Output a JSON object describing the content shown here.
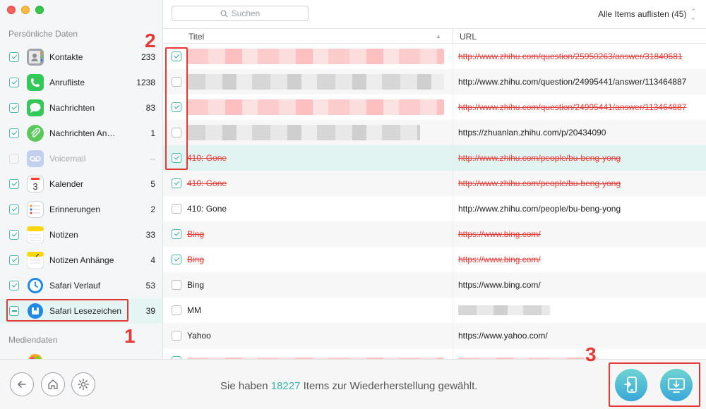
{
  "sidebar": {
    "section_personal": "Persönliche Daten",
    "section_media": "Mediendaten",
    "categories": [
      {
        "name": "Kontakte",
        "count": "233",
        "state": "checked",
        "color": "#8e8e93",
        "icon": "contacts-icon"
      },
      {
        "name": "Anrufliste",
        "count": "1238",
        "state": "checked",
        "color": "#34c759",
        "icon": "phone-icon"
      },
      {
        "name": "Nachrichten",
        "count": "83",
        "state": "checked",
        "color": "#34c759",
        "icon": "messages-icon"
      },
      {
        "name": "Nachrichten An…",
        "count": "1",
        "state": "checked",
        "color": "#5ac85a",
        "icon": "paperclip-icon"
      },
      {
        "name": "Voicemail",
        "count": "--",
        "state": "disabled",
        "color": "#9fb8e6",
        "icon": "voicemail-icon"
      },
      {
        "name": "Kalender",
        "count": "5",
        "state": "checked",
        "color": "#ffffff",
        "icon": "calendar-icon",
        "calendar_day": "3"
      },
      {
        "name": "Erinnerungen",
        "count": "2",
        "state": "checked",
        "color": "#ffffff",
        "icon": "reminders-icon"
      },
      {
        "name": "Notizen",
        "count": "33",
        "state": "checked",
        "color": "#ffd60a",
        "icon": "notes-icon"
      },
      {
        "name": "Notizen Anhänge",
        "count": "4",
        "state": "checked",
        "color": "#ffd60a",
        "icon": "notes-attachment-icon"
      },
      {
        "name": "Safari Verlauf",
        "count": "53",
        "state": "checked",
        "color": "#1e88e5",
        "icon": "safari-history-icon"
      },
      {
        "name": "Safari Lesezeichen",
        "count": "39",
        "state": "partial",
        "color": "#1e88e5",
        "icon": "safari-bookmark-icon",
        "selected": true
      }
    ]
  },
  "toolbar": {
    "search_placeholder": "Suchen",
    "filter_label": "Alle Items auflisten (45)"
  },
  "table": {
    "col_title": "Titel",
    "col_url": "URL",
    "rows": [
      {
        "checked": true,
        "title": "",
        "url": "http://www.zhihu.com/question/25950263/answer/31840681",
        "deleted": true,
        "blur_title": "red"
      },
      {
        "checked": false,
        "title": "",
        "url": "http://www.zhihu.com/question/24995441/answer/113464887",
        "deleted": false,
        "blur_title": "grey"
      },
      {
        "checked": true,
        "title": "",
        "url": "http://www.zhihu.com/question/24995441/answer/113464887",
        "deleted": true,
        "blur_title": "red"
      },
      {
        "checked": false,
        "title": "",
        "url": "https://zhuanlan.zhihu.com/p/20434090",
        "deleted": false,
        "blur_title": "grey"
      },
      {
        "checked": true,
        "title": "410: Gone",
        "url": "http://www.zhihu.com/people/bu-beng-yong",
        "deleted": true,
        "highlight": true
      },
      {
        "checked": true,
        "title": "410: Gone",
        "url": "http://www.zhihu.com/people/bu-beng-yong",
        "deleted": true
      },
      {
        "checked": false,
        "title": "410: Gone",
        "url": "http://www.zhihu.com/people/bu-beng-yong",
        "deleted": false
      },
      {
        "checked": true,
        "title": "Bing",
        "url": "https://www.bing.com/",
        "deleted": true
      },
      {
        "checked": true,
        "title": "Bing",
        "url": "https://www.bing.com/",
        "deleted": true
      },
      {
        "checked": false,
        "title": "Bing",
        "url": "https://www.bing.com/",
        "deleted": false
      },
      {
        "checked": false,
        "title": "MM",
        "url": "",
        "deleted": false,
        "blur_url": "grey"
      },
      {
        "checked": false,
        "title": "Yahoo",
        "url": "https://www.yahoo.com/",
        "deleted": false
      },
      {
        "checked": true,
        "title": "",
        "url": "",
        "deleted": true,
        "blur_title": "red-thin",
        "blur_url": "red-thin"
      }
    ]
  },
  "footer": {
    "status_prefix": "Sie haben",
    "status_count": "18227",
    "status_suffix": "Items zur Wiederherstellung gewählt."
  },
  "annotations": {
    "step1": "1",
    "step2": "2",
    "step3": "3"
  },
  "colors": {
    "accent": "#35b3a5",
    "deleted": "#e53935",
    "highlight": "#e2f4f2"
  }
}
